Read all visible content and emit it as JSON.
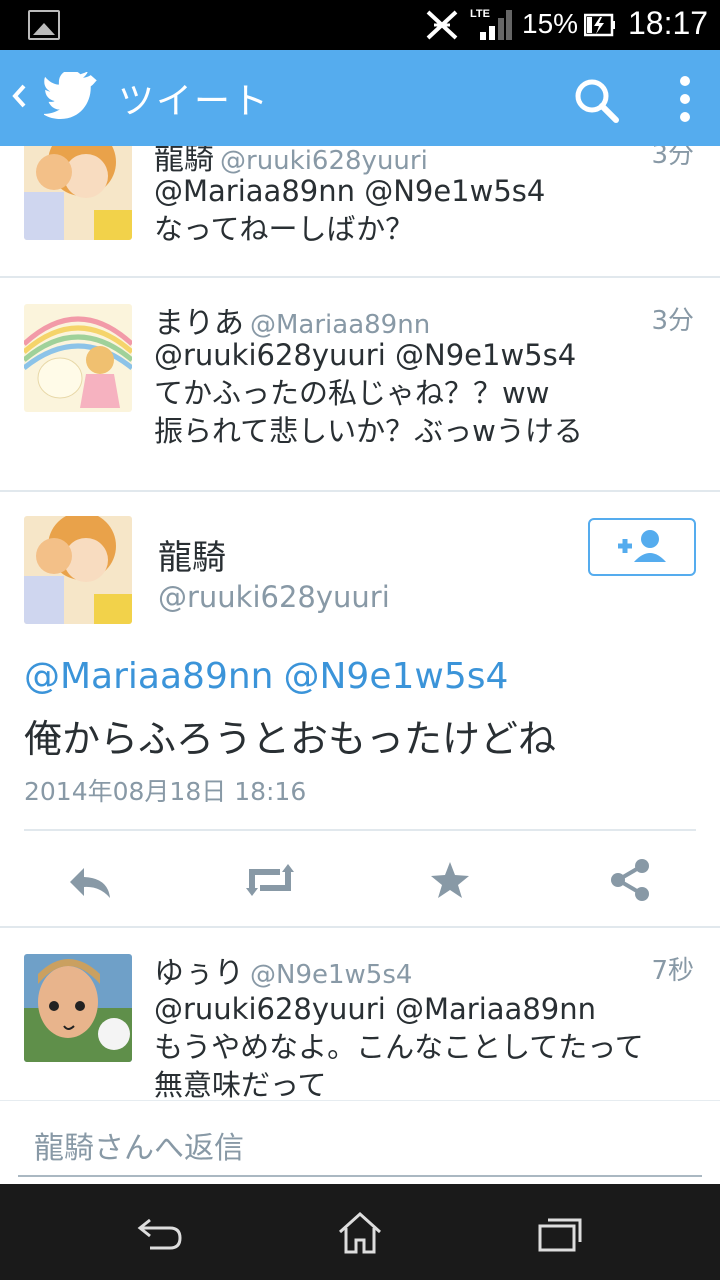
{
  "status": {
    "battery_percent": "15%",
    "time": "18:17",
    "network": "LTE"
  },
  "appbar": {
    "title": "ツイート"
  },
  "tweets": [
    {
      "name": "龍騎",
      "handle": "@ruuki628yuuri",
      "time": "3分",
      "lines": [
        "@Mariaa89nn @N9e1w5s4",
        "なってねーしばか？"
      ]
    },
    {
      "name": "まりあ",
      "handle": "@Mariaa89nn",
      "time": "3分",
      "lines": [
        "@ruuki628yuuri @N9e1w5s4",
        "てかふったの私じゃね？？ww",
        "振られて悲しいか？ぶっwうける"
      ]
    },
    {
      "name": "ゆぅり",
      "handle": "@N9e1w5s4",
      "time": "7秒",
      "lines": [
        "@ruuki628yuuri @Mariaa89nn",
        "もうやめなよ。こんなことしてたって",
        "無意味だって"
      ]
    }
  ],
  "focused": {
    "name": "龍騎",
    "handle": "@ruuki628yuuri",
    "mentions": [
      "@Mariaa89nn",
      "@N9e1w5s4"
    ],
    "text": "俺からふろうとおもったけどね",
    "date": "2014年08月18日 18:16"
  },
  "reply": {
    "placeholder": "龍騎さんへ返信"
  },
  "colors": {
    "twitter_blue": "#55acee",
    "link_blue": "#3b94d9",
    "meta_gray": "#8899a6"
  }
}
